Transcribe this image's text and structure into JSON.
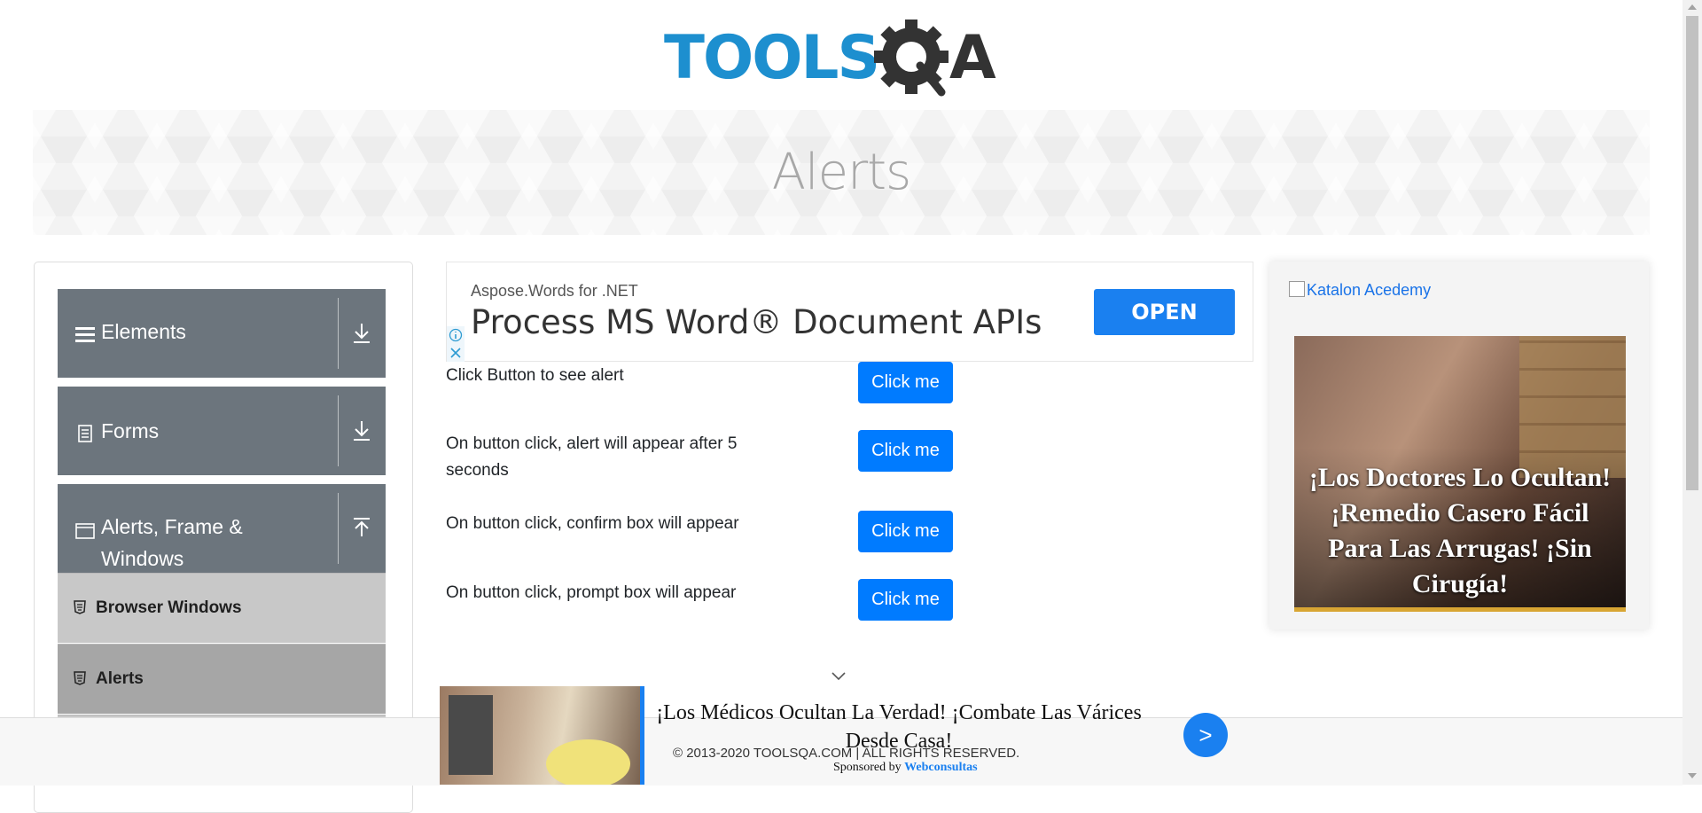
{
  "header": {
    "logo_text_left": "TOOLS",
    "logo_text_right": "QA",
    "page_title": "Alerts"
  },
  "sidebar": {
    "groups": [
      {
        "label": "Elements",
        "icon": "hamburger-icon",
        "toggle_icon": "download-arrow-icon"
      },
      {
        "label": "Forms",
        "icon": "document-icon",
        "toggle_icon": "download-arrow-icon"
      },
      {
        "label": "Alerts, Frame & Windows",
        "label_line1": "Alerts, Frame &",
        "label_line2": "Windows",
        "icon": "window-icon",
        "toggle_icon": "upload-arrow-icon"
      }
    ],
    "items": [
      {
        "label": "Browser Windows",
        "icon": "html5-icon",
        "background": "#c8c8c8"
      },
      {
        "label": "Alerts",
        "icon": "html5-icon",
        "background": "#a6a6a6"
      }
    ]
  },
  "ad_top": {
    "brand": "Aspose.Words for .NET",
    "headline": "Process MS Word® Document APIs",
    "button": "OPEN"
  },
  "alerts": [
    {
      "label": "Click Button to see alert",
      "button": "Click me"
    },
    {
      "label": "On button click, alert will appear after 5 seconds",
      "button": "Click me"
    },
    {
      "label": "On button click, confirm box will appear",
      "button": "Click me"
    },
    {
      "label": "On button click, prompt box will appear",
      "button": "Click me"
    }
  ],
  "ad_right": {
    "link_text": "Katalon Acedemy",
    "headline": "¡Los Doctores Lo Ocultan! ¡Remedio Casero Fácil Para Las Arrugas! ¡Sin Cirugía!"
  },
  "ad_bottom": {
    "headline": "¡Los Médicos Ocultan La Verdad! ¡Combate Las Várices Desde Casa!",
    "button": ">",
    "sponsored_prefix": "Sponsored by",
    "sponsor": "Webconsultas"
  },
  "footer": {
    "copyright": "© 2013-2020 TOOLSQA.COM | ALL RIGHTS RESERVED."
  },
  "colors": {
    "primary_button": "#007bff",
    "sidebar_group": "#6c757d",
    "logo_blue": "#1d8fcf",
    "logo_dark": "#333333",
    "ad_blue": "#1a80f0"
  }
}
